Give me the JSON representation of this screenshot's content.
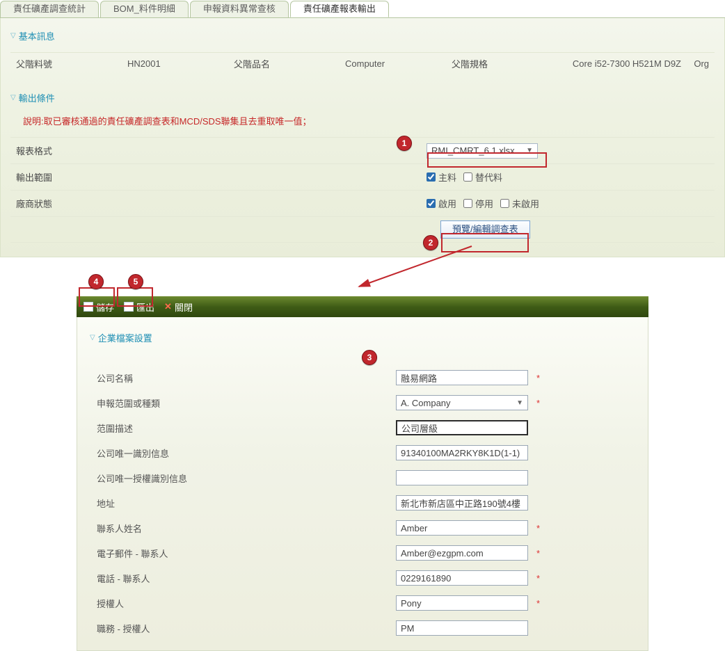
{
  "tabs": [
    "責任礦產調查統計",
    "BOM_料件明細",
    "申報資料異常查核",
    "責任礦產報表輸出"
  ],
  "active_tab_index": 3,
  "sections": {
    "basic_title": "基本訊息",
    "output_title": "輸出條件",
    "ent_title": "企業檔案設置"
  },
  "basic": {
    "f_partno_lbl": "父階料號",
    "f_partno_val": "HN2001",
    "f_name_lbl": "父階品名",
    "f_name_val": "Computer",
    "f_spec_lbl": "父階規格",
    "f_spec_val": "Core i52-7300 H521M D9Z",
    "org_lbl": "Org"
  },
  "note": "說明:取已審核通過的責任礦產調查表和MCD/SDS聯集且去重取唯一值；",
  "filters": {
    "format_lbl": "報表格式",
    "format_val": "RMI_CMRT_6.1.xlsx",
    "scope_lbl": "輸出範圍",
    "scope_main": "主料",
    "scope_main_checked": true,
    "scope_alt": "替代料",
    "scope_alt_checked": false,
    "vendor_lbl": "廠商狀態",
    "vendor_on": "啟用",
    "vendor_on_checked": true,
    "vendor_off": "停用",
    "vendor_off_checked": false,
    "vendor_na": "未啟用",
    "vendor_na_checked": false,
    "preview_btn": "預覽/編輯調查表"
  },
  "toolbar": {
    "save": "儲存",
    "export": "匯出",
    "close": "關閉"
  },
  "ent": {
    "company_lbl": "公司名稱",
    "company_val": "融易網路",
    "decl_lbl": "申報范圍或種類",
    "decl_val": "A. Company",
    "scopedesc_lbl": "范圍描述",
    "scopedesc_val": "公司層級",
    "uid_lbl": "公司唯一識別信息",
    "uid_val": "91340100MA2RKY8K1D(1-1)",
    "authid_lbl": "公司唯一授權識別信息",
    "authid_val": "",
    "addr_lbl": "地址",
    "addr_val": "新北市新店區中正路190號4樓",
    "contact_lbl": "聯系人姓名",
    "contact_val": "Amber",
    "email_lbl": "電子郵件 - 聯系人",
    "email_val": "Amber@ezgpm.com",
    "phone_lbl": "電話 - 聯系人",
    "phone_val": "0229161890",
    "auth_lbl": "授權人",
    "auth_val": "Pony",
    "title_lbl": "職務 - 授權人",
    "title_val": "PM"
  },
  "badges": {
    "b1": "1",
    "b2": "2",
    "b3": "3",
    "b4": "4",
    "b5": "5"
  }
}
